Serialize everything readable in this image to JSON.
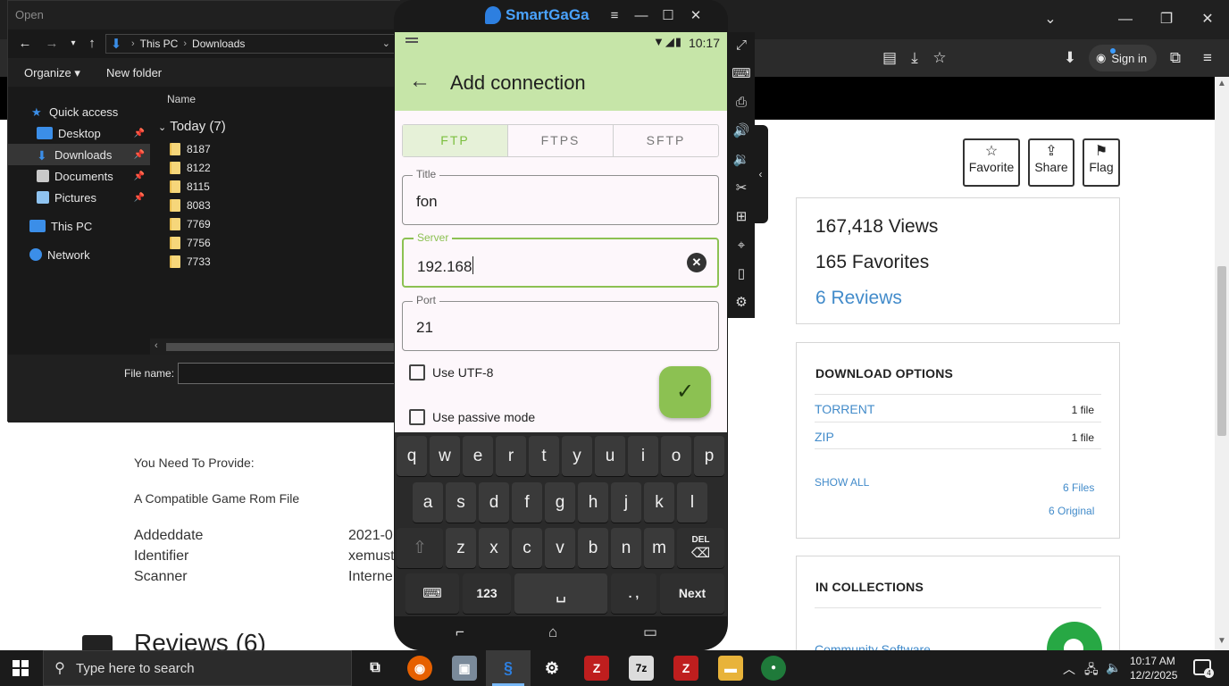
{
  "browser": {
    "signin_label": "Sign in",
    "actions": [
      {
        "icon": "star-icon",
        "glyph": "☆",
        "label": "Favorite"
      },
      {
        "icon": "share-icon",
        "glyph": "⇪",
        "label": "Share"
      },
      {
        "icon": "flag-icon",
        "glyph": "⚑",
        "label": "Flag"
      }
    ],
    "stats": {
      "views": "167,418 Views",
      "favorites": "165 Favorites",
      "reviews": "6 Reviews"
    },
    "download_options": {
      "heading": "DOWNLOAD OPTIONS",
      "rows": [
        {
          "name": "TORRENT",
          "count": "1 file"
        },
        {
          "name": "ZIP",
          "count": "1 file"
        }
      ],
      "show_all": "SHOW ALL",
      "files_link": "6 Files",
      "original_link": "6 Original"
    },
    "collections": {
      "heading": "IN COLLECTIONS",
      "first": "Community Software"
    },
    "content": {
      "provide_label": "You Need To Provide:",
      "requirement": "A Compatible Game Rom File",
      "meta": [
        {
          "key": "Addeddate",
          "value": "2021-0"
        },
        {
          "key": "Identifier",
          "value": "xemust"
        },
        {
          "key": "Scanner",
          "value": "Interne"
        }
      ],
      "reviews_heading": "Reviews (6)"
    }
  },
  "file_dialog": {
    "title": "Open",
    "path": [
      "This PC",
      "Downloads"
    ],
    "organize_label": "Organize ▾",
    "new_folder_label": "New folder",
    "nav": [
      {
        "label": "Quick access",
        "icon": "star-icon",
        "color": "#3b8ee8",
        "pinned": false
      },
      {
        "label": "Desktop",
        "icon": "desktop-icon",
        "color": "#3b8ee8",
        "pinned": true
      },
      {
        "label": "Downloads",
        "icon": "download-icon",
        "color": "#3b8ee8",
        "pinned": true,
        "selected": true
      },
      {
        "label": "Documents",
        "icon": "documents-icon",
        "color": "#c9c9c9",
        "pinned": true
      },
      {
        "label": "Pictures",
        "icon": "pictures-icon",
        "color": "#8fc3f0",
        "pinned": true
      },
      {
        "label": "This PC",
        "icon": "computer-icon",
        "color": "#3b8ee8",
        "pinned": false
      },
      {
        "label": "Network",
        "icon": "network-icon",
        "color": "#3b8ee8",
        "pinned": false
      }
    ],
    "column_name": "Name",
    "group_label": "Today (7)",
    "files": [
      "8187",
      "8122",
      "8115",
      "8083",
      "7769",
      "7756",
      "7733"
    ],
    "file_name_label": "File name:",
    "file_name_value": ""
  },
  "emulator": {
    "brand": "SmartGaGa",
    "status_time": "10:17",
    "screen_title": "Add connection",
    "tabs": [
      {
        "label": "FTP",
        "active": true
      },
      {
        "label": "FTPS",
        "active": false
      },
      {
        "label": "SFTP",
        "active": false
      }
    ],
    "fields": {
      "title": {
        "label": "Title",
        "value": "fon"
      },
      "server": {
        "label": "Server",
        "value": "192.168"
      },
      "port": {
        "label": "Port",
        "value": "21"
      }
    },
    "checkboxes": {
      "utf8": "Use UTF-8",
      "passive": "Use passive mode"
    },
    "keyboard": {
      "row1": [
        "q",
        "w",
        "e",
        "r",
        "t",
        "y",
        "u",
        "i",
        "o",
        "p"
      ],
      "row2": [
        "a",
        "s",
        "d",
        "f",
        "g",
        "h",
        "j",
        "k",
        "l"
      ],
      "row3": [
        "z",
        "x",
        "c",
        "v",
        "b",
        "n",
        "m"
      ],
      "del_label": "DEL",
      "num_label": "123",
      "punct_label": ". ,",
      "next_label": "Next"
    }
  },
  "taskbar": {
    "search_placeholder": "Type here to search",
    "time": "10:17 AM",
    "date": "12/2/2025",
    "notifications": "4"
  }
}
